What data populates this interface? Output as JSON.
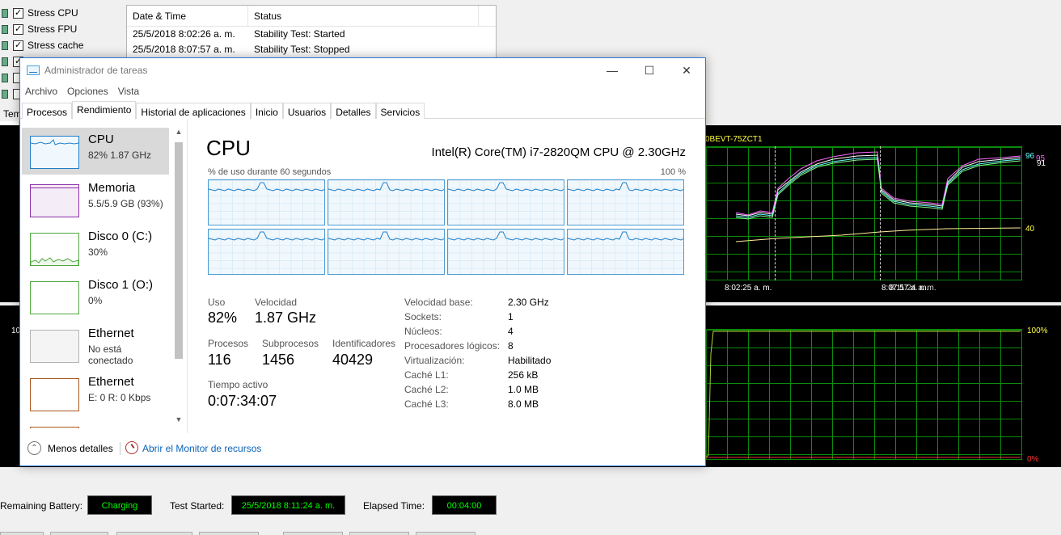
{
  "background_app": {
    "checks": [
      {
        "label": "Stress CPU",
        "checked": true
      },
      {
        "label": "Stress FPU",
        "checked": true
      },
      {
        "label": "Stress cache",
        "checked": true
      },
      {
        "label": "",
        "checked": true
      },
      {
        "label": "",
        "checked": false
      },
      {
        "label": "",
        "checked": false
      }
    ],
    "tab_partial": "Tem",
    "log": {
      "headers": [
        "Date & Time",
        "Status"
      ],
      "rows": [
        {
          "time": "25/5/2018 8:02:26 a. m.",
          "status": "Stability Test: Started"
        },
        {
          "time": "25/5/2018 8:07:57 a. m.",
          "status": "Stability Test: Stopped"
        }
      ]
    },
    "temp_graph": {
      "title": "0BEVT-75ZCT1",
      "label_96": "96",
      "label_95": "95",
      "label_91": "91",
      "label_40": "40",
      "time_1": "8:02:25 a. m.",
      "time_2": "8:07:57 a. m.",
      "time_2_overlap": "8:11:24 a. m."
    },
    "usage_graph": {
      "left_label": "10",
      "label_100": "100%",
      "label_0": "0%"
    },
    "status": {
      "battery_label": "Remaining Battery:",
      "battery_value": "Charging",
      "started_label": "Test Started:",
      "started_value": "25/5/2018 8:11:24 a. m.",
      "elapsed_label": "Elapsed Time:",
      "elapsed_value": "00:04:00"
    }
  },
  "task_manager": {
    "title": "Administrador de tareas",
    "menu": [
      "Archivo",
      "Opciones",
      "Vista"
    ],
    "tabs": [
      "Procesos",
      "Rendimiento",
      "Historial de aplicaciones",
      "Inicio",
      "Usuarios",
      "Detalles",
      "Servicios"
    ],
    "active_tab": "Rendimiento",
    "sidebar": [
      {
        "name": "CPU",
        "sub": "82%  1.87 GHz",
        "color": "#1e7fc7",
        "selected": true
      },
      {
        "name": "Memoria",
        "sub": "5.5/5.9 GB (93%)",
        "color": "#8b2fa6",
        "selected": false
      },
      {
        "name": "Disco 0 (C:)",
        "sub": "30%",
        "color": "#4ea73c",
        "selected": false
      },
      {
        "name": "Disco 1 (O:)",
        "sub": "0%",
        "color": "#4ea73c",
        "selected": false
      },
      {
        "name": "Ethernet",
        "sub": "No está conectado",
        "color": "#b3b3b3",
        "selected": false
      },
      {
        "name": "Ethernet",
        "sub": "E: 0 R: 0 Kbps",
        "color": "#a7561b",
        "selected": false
      }
    ],
    "main": {
      "heading": "CPU",
      "cpu_name": "Intel(R) Core(TM) i7-2820QM CPU @ 2.30GHz",
      "graph_label": "% de uso durante 60 segundos",
      "graph_max": "100 %",
      "core_count": 8,
      "stats": {
        "uso_label": "Uso",
        "uso_value": "82%",
        "velocidad_label": "Velocidad",
        "velocidad_value": "1.87 GHz",
        "procesos_label": "Procesos",
        "procesos_value": "116",
        "subprocesos_label": "Subprocesos",
        "subprocesos_value": "1456",
        "ident_label": "Identificadores",
        "ident_value": "40429",
        "tiempo_label": "Tiempo activo",
        "tiempo_value": "0:07:34:07"
      },
      "specs": [
        {
          "k": "Velocidad base:",
          "v": "2.30 GHz"
        },
        {
          "k": "Sockets:",
          "v": "1"
        },
        {
          "k": "Núcleos:",
          "v": "4"
        },
        {
          "k": "Procesadores lógicos:",
          "v": "8"
        },
        {
          "k": "Virtualización:",
          "v": "Habilitado"
        },
        {
          "k": "Caché L1:",
          "v": "256 kB"
        },
        {
          "k": "Caché L2:",
          "v": "1.0 MB"
        },
        {
          "k": "Caché L3:",
          "v": "8.0 MB"
        }
      ]
    },
    "footer": {
      "less_details": "Menos detalles",
      "resource_monitor": "Abrir el Monitor de recursos"
    }
  }
}
